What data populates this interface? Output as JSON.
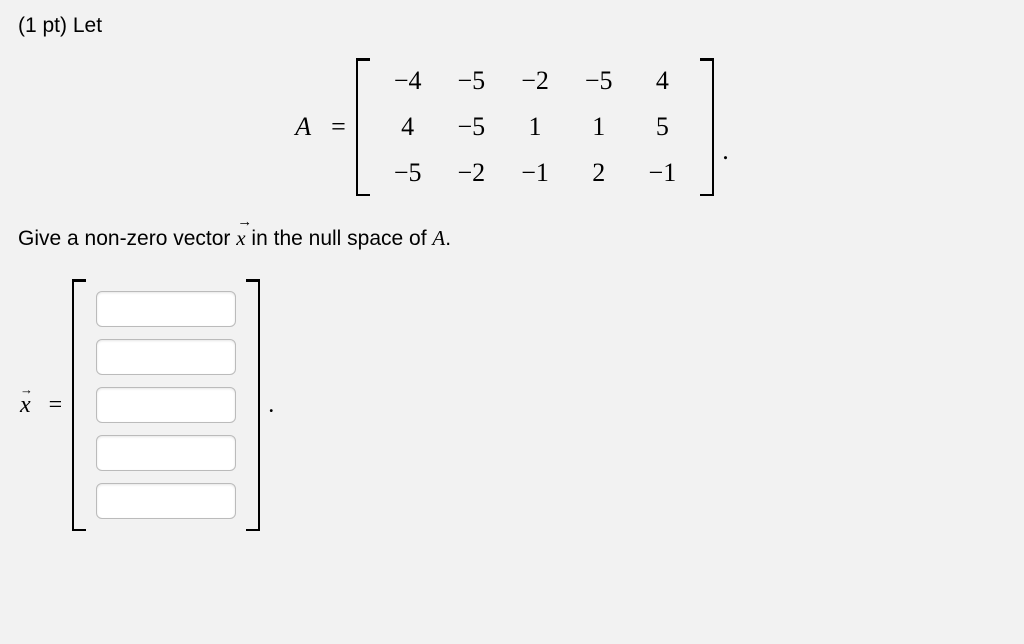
{
  "header": "(1 pt) Let",
  "matrix": {
    "label": "A",
    "equals": "=",
    "rows": [
      [
        "−4",
        "−5",
        "−2",
        "−5",
        "4"
      ],
      [
        "4",
        "−5",
        "1",
        "1",
        "5"
      ],
      [
        "−5",
        "−2",
        "−1",
        "2",
        "−1"
      ]
    ],
    "period": "."
  },
  "prompt": {
    "pre": "Give a non-zero vector ",
    "vec": "x",
    "post": " in the null space of ",
    "post_A": "A",
    "post_end": "."
  },
  "answer": {
    "vec_label": "x",
    "equals": "=",
    "inputs": [
      "",
      "",
      "",
      "",
      ""
    ],
    "period": "."
  }
}
